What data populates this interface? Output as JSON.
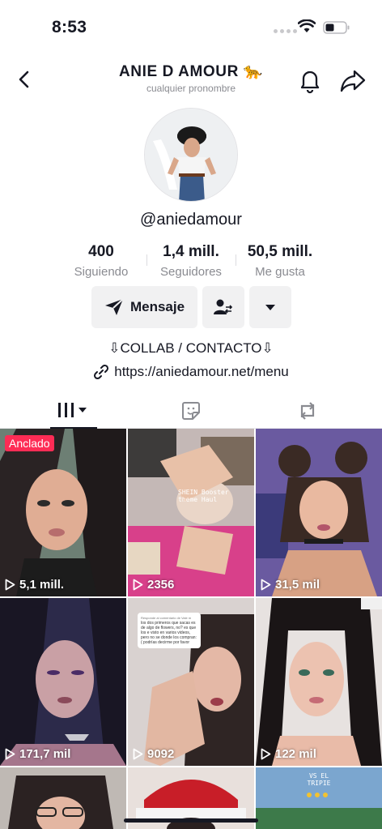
{
  "status": {
    "time": "8:53"
  },
  "header": {
    "title": "ANIE D AMOUR 🐆",
    "pronouns": "cualquier pronombre"
  },
  "profile": {
    "username": "@aniedamour",
    "stats": [
      {
        "value": "400",
        "label": "Siguiendo"
      },
      {
        "value": "1,4 mill.",
        "label": "Seguidores"
      },
      {
        "value": "50,5 mill.",
        "label": "Me gusta"
      }
    ],
    "message_label": "Mensaje",
    "bio_contact": "⇩COLLAB / CONTACTO⇩",
    "bio_link": "https://aniedamour.net/menu"
  },
  "tabs": [
    "videos-grid-icon",
    "liked-icon",
    "reposts-icon"
  ],
  "videos": [
    {
      "views": "5,1 mill.",
      "pinned_label": "Anclado"
    },
    {
      "views": "2356",
      "overlay": "SHEIN Booster theme Haul"
    },
    {
      "views": "31,5 mil"
    },
    {
      "views": "171,7 mil"
    },
    {
      "views": "9092",
      "comment_title": "Responde al comentario de Vale m",
      "comment_text": "los dos primeros que sacas es de algo de flowers, no? es que los e visto en varios videos, pero no se donde los compran:( podrías decirme por favor"
    },
    {
      "views": "122 mil"
    },
    {
      "views": ""
    },
    {
      "views": ""
    },
    {
      "views": "",
      "overlay": "VS EL TRIPIE"
    }
  ],
  "colors": {
    "accent": "#fe2c55",
    "text": "#161823",
    "muted": "#8a8b91"
  }
}
